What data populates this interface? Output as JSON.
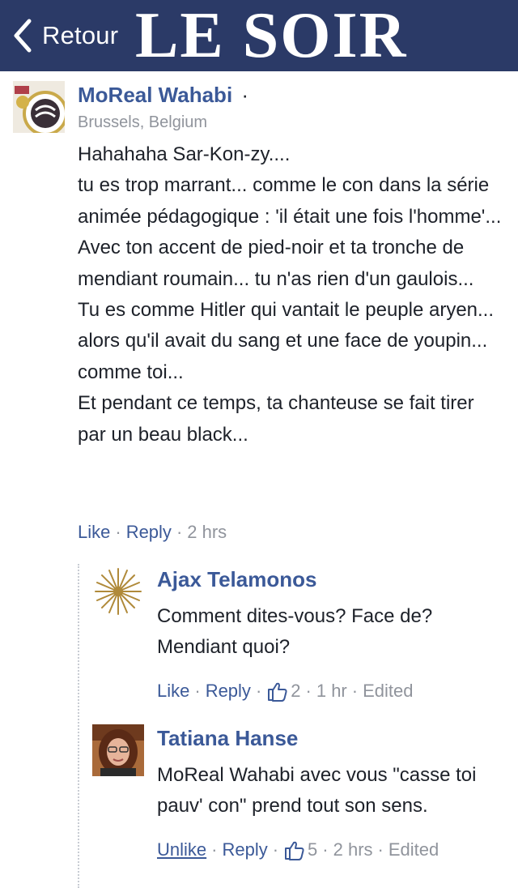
{
  "header": {
    "back_label": "Retour",
    "logo_text": "LE SOIR",
    "background": "#2b3a67"
  },
  "comment": {
    "author": "MoReal Wahabi",
    "author_dot": "·",
    "location": "Brussels, Belgium",
    "text": "Hahahaha Sar-Kon-zy....\ntu es trop marrant... comme le con dans la série animée pédagogique : 'il était une fois l'homme'...\nAvec ton accent de pied-noir et ta tronche de mendiant roumain... tu n'as rien d'un gaulois...\nTu es comme Hitler qui vantait le peuple aryen... alors qu'il avait du sang et une face de youpin... comme toi...\nEt pendant ce temps, ta chanteuse se fait tirer par un beau black...",
    "like_label": "Like",
    "reply_label": "Reply",
    "time": "2 hrs",
    "avatar_icon": "football-crest-icon"
  },
  "replies": [
    {
      "author": "Ajax Telamonos",
      "text": "Comment dites-vous? Face de?\nMendiant quoi?",
      "like_label": "Like",
      "reply_label": "Reply",
      "likes": "2",
      "time": "1 hr",
      "edited": "Edited",
      "avatar_icon": "vergina-sun-icon"
    },
    {
      "author": "Tatiana Hanse",
      "text": "MoReal Wahabi avec vous \"casse toi pauv' con\" prend tout son sens.",
      "like_label": "Unlike",
      "reply_label": "Reply",
      "likes": "5",
      "time": "2 hrs",
      "edited": "Edited",
      "avatar_icon": "person-photo-icon"
    }
  ],
  "colors": {
    "link": "#3b5998",
    "muted": "#90949c",
    "text": "#1d2129"
  }
}
